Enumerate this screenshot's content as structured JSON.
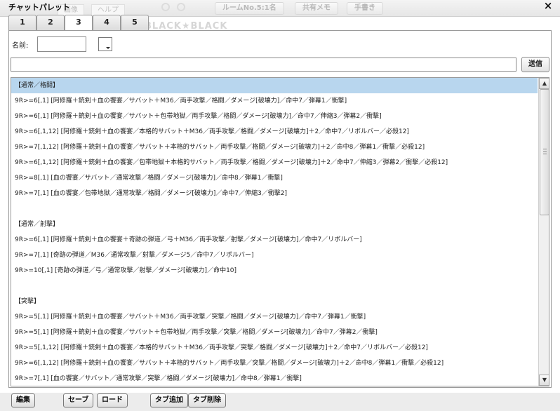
{
  "window": {
    "title": "チャットパレット",
    "close_label": "×"
  },
  "background": {
    "tabs": [
      "画像",
      "ヘルプ"
    ],
    "buttons": [
      "ルームNo.5:1名",
      "共有メモ",
      "手書き"
    ],
    "ghost_text": "BLACK★BLACK"
  },
  "tabs": [
    "1",
    "2",
    "3",
    "4",
    "5"
  ],
  "active_tab_index": 2,
  "form": {
    "name_label": "名前:",
    "name_value": "",
    "message_value": "",
    "send_label": "送信"
  },
  "palette_lines": [
    "【通常／格闘】",
    "9R>=6[,1] [阿修羅＋銃剣＋血の饗宴／サバット＋M36／両手攻撃／格闘／ダメージ[破壊力]／命中7／弾幕1／衝撃]",
    "9R>=6[,1] [阿修羅＋銃剣＋血の饗宴／サバット＋包帯地獄／両手攻撃／格闘／ダメージ[破壊力]／命中7／伸縮3／弾幕2／衝撃]",
    "9R>=6[,1,12] [阿修羅＋銃剣＋血の饗宴／本格的サバット＋M36／両手攻撃／格闘／ダメージ[破壊力]＋2／命中7／リボルバー／必殺12]",
    "9R>=7[,1,12] [阿修羅＋銃剣＋血の饗宴／サバット＋本格的サバット／両手攻撃／格闘／ダメージ[破壊力]＋2／命中8／弾幕1／衝撃／必殺12]",
    "9R>=6[,1,12] [阿修羅＋銃剣＋血の饗宴／包帯地獄＋本格的サバット／両手攻撃／格闘／ダメージ[破壊力]＋2／命中7／伸縮3／弾幕2／衝撃／必殺12]",
    "9R>=8[,1] [血の饗宴／サバット／通常攻撃／格闘／ダメージ[破壊力]／命中8／弾幕1／衝撃]",
    "9R>=7[,1] [血の饗宴／包帯地獄／通常攻撃／格闘／ダメージ[破壊力]／命中7／伸縮3／衝撃2]",
    "",
    "【通常／射撃】",
    "9R>=6[,1] [阿修羅＋銃剣＋血の饗宴＋奇跡の弾道／弓＋M36／両手攻撃／射撃／ダメージ[破壊力]／命中7／リボルバー]",
    "9R>=7[,1] [奇跡の弾道／M36／通常攻撃／射撃／ダメージ5／命中7／リボルバー]",
    "9R>=10[,1] [奇跡の弾道／弓／通常攻撃／射撃／ダメージ[破壊力]／命中10]",
    "",
    "【突撃】",
    "9R>=5[,1] [阿修羅＋銃剣＋血の饗宴／サバット＋M36／両手攻撃／突撃／格闘／ダメージ[破壊力]／命中7／弾幕1／衝撃]",
    "9R>=5[,1] [阿修羅＋銃剣＋血の饗宴／サバット＋包帯地獄／両手攻撃／突撃／格闘／ダメージ[破壊力]／命中7／弾幕2／衝撃]",
    "9R>=5[,1,12] [阿修羅＋銃剣＋血の饗宴／本格的サバット＋M36／両手攻撃／突撃／格闘／ダメージ[破壊力]＋2／命中7／リボルバー／必殺12]",
    "9R>=6[,1,12] [阿修羅＋銃剣＋血の饗宴／サバット＋本格的サバット／両手攻撃／突撃／格闘／ダメージ[破壊力]＋2／命中8／弾幕1／衝撃／必殺12]",
    "9R>=7[,1] [血の饗宴／サバット／通常攻撃／突撃／格闘／ダメージ[破壊力]／命中8／弾幕1／衝撃]"
  ],
  "selected_line_index": 0,
  "footer_buttons": [
    {
      "name": "edit-button",
      "label": "編集"
    },
    {
      "name": "save-button",
      "label": "セーブ"
    },
    {
      "name": "load-button",
      "label": "ロード"
    },
    {
      "name": "add-tab-button",
      "label": "タブ追加"
    },
    {
      "name": "delete-tab-button",
      "label": "タブ削除"
    }
  ]
}
